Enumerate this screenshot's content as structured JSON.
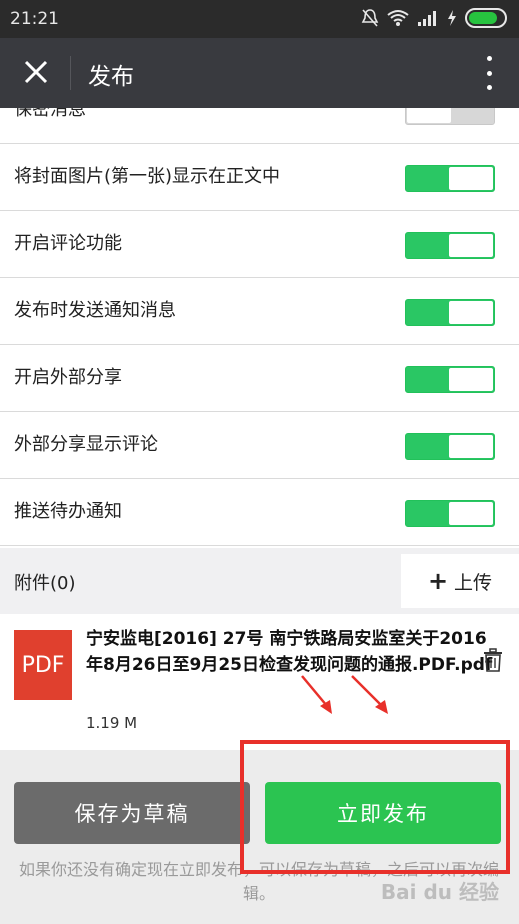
{
  "status_bar": {
    "time": "21:21"
  },
  "header": {
    "title": "发布"
  },
  "settings": [
    {
      "label": "保密消息",
      "on": false
    },
    {
      "label": "将封面图片(第一张)显示在正文中",
      "on": true
    },
    {
      "label": "开启评论功能",
      "on": true
    },
    {
      "label": "发布时发送通知消息",
      "on": true
    },
    {
      "label": "开启外部分享",
      "on": true
    },
    {
      "label": "外部分享显示评论",
      "on": true
    },
    {
      "label": "推送待办通知",
      "on": true
    }
  ],
  "attachments": {
    "title": "附件(0)",
    "upload_label": "上传",
    "upload_icon": "+"
  },
  "file": {
    "icon_text": "PDF",
    "name": "宁安监电[2016] 27号 南宁铁路局安监室关于2016年8月26日至9月25日检查发现问题的通报.PDF.pdf",
    "size": "1.19 M"
  },
  "actions": {
    "draft_label": "保存为草稿",
    "publish_label": "立即发布",
    "hint": "如果你还没有确定现在立即发布，可以保存为草稿，之后可以再次编辑。"
  },
  "watermark": "Bai du 经验",
  "colors": {
    "accent": "#2bc451",
    "header_bg": "#393a3f",
    "annotation": "#e8302a"
  }
}
